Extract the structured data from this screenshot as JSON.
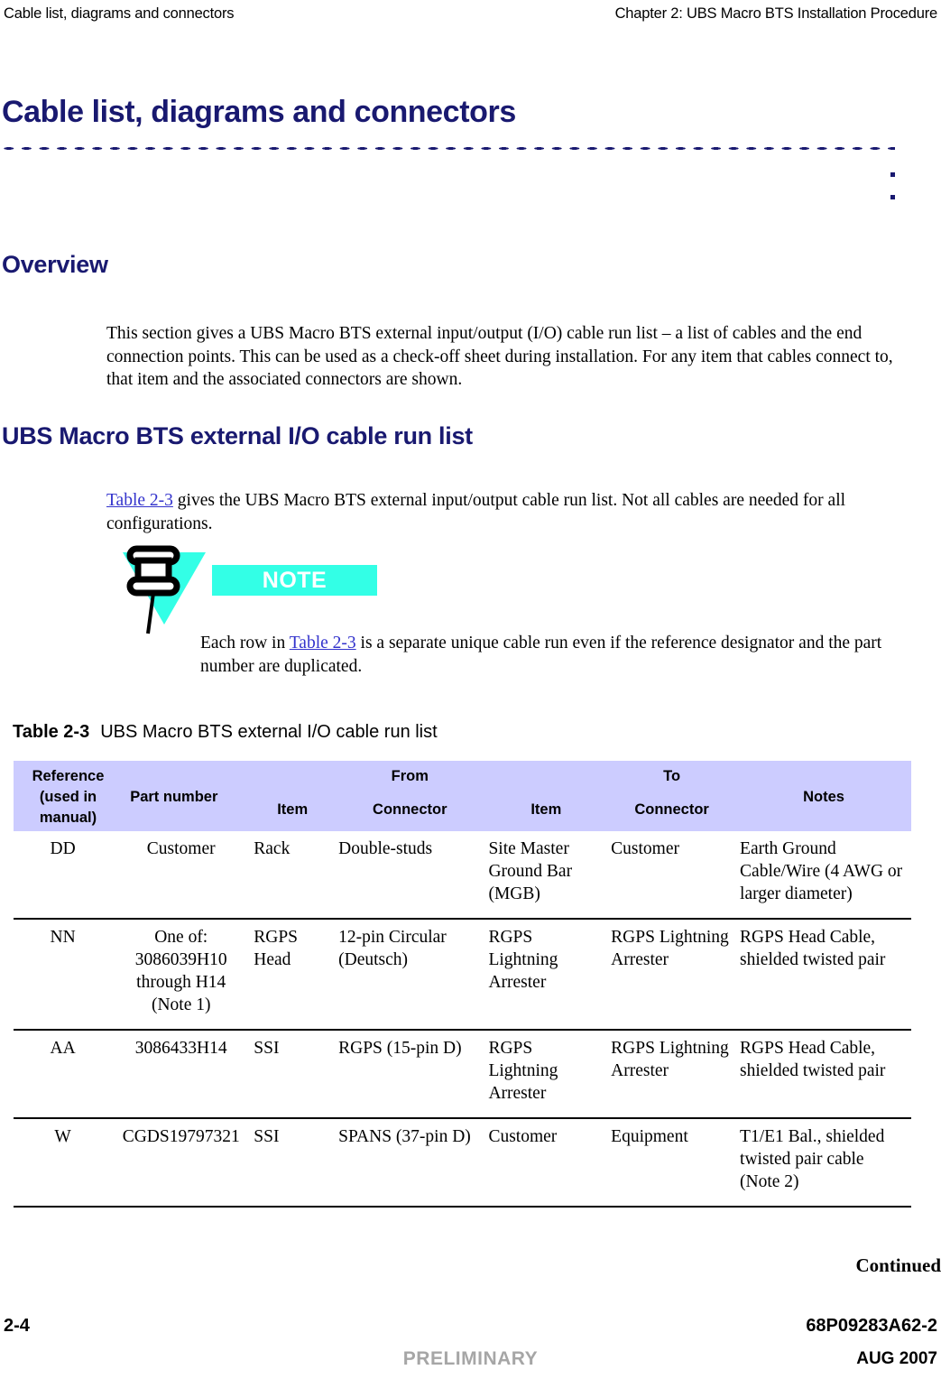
{
  "running_head": {
    "left": "Cable list, diagrams and connectors",
    "right": "Chapter 2: UBS Macro BTS Installation Procedure"
  },
  "chapter_title": "Cable list, diagrams and connectors",
  "sections": {
    "overview": {
      "heading": "Overview",
      "paragraph": "This section gives a UBS Macro BTS external input/output (I/O) cable run list – a list of cables and the end connection points. This can be used as a check-off sheet during installation. For any item that cables connect to, that item and the associated connectors are shown."
    },
    "runlist": {
      "heading": "UBS Macro BTS external I/O cable run list",
      "paragraph_xref": "Table 2-3",
      "paragraph_rest": " gives the UBS Macro BTS external input/output cable run list. Not all cables are needed for all configurations."
    }
  },
  "note": {
    "label": "NOTE",
    "text_before_xref": "Each row in ",
    "xref": "Table 2-3",
    "text_after_xref": " is a separate unique cable run even if the reference designator and the part number are duplicated."
  },
  "table": {
    "caption_number": "Table 2-3",
    "caption_text": "UBS Macro BTS external I/O cable run list",
    "header": {
      "reference": "Reference (used in manual)",
      "part_number": "Part number",
      "from": "From",
      "to": "To",
      "from_item": "Item",
      "from_connector": "Connector",
      "to_item": "Item",
      "to_connector": "Connector",
      "notes": "Notes"
    },
    "rows": [
      {
        "reference": "DD",
        "part_number": "Customer",
        "from_item": "Rack",
        "from_connector": "Double-studs",
        "to_item": "Site Master Ground Bar (MGB)",
        "to_connector": "Customer",
        "notes": "Earth Ground Cable/Wire (4 AWG or larger diameter)"
      },
      {
        "reference": "NN",
        "part_number": "One of: 3086039H10 through H14 (Note 1)",
        "from_item": "RGPS Head",
        "from_connector": "12-pin Circular (Deutsch)",
        "to_item": "RGPS Lightning Arrester",
        "to_connector": "RGPS Lightning Arrester",
        "notes": "RGPS Head Cable, shielded twisted pair"
      },
      {
        "reference": "AA",
        "part_number": "3086433H14",
        "from_item": "SSI",
        "from_connector": "RGPS (15-pin D)",
        "to_item": "RGPS Lightning Arrester",
        "to_connector": "RGPS Lightning Arrester",
        "notes": "RGPS Head Cable, shielded twisted pair"
      },
      {
        "reference": "W",
        "part_number": "CGDS19797321",
        "from_item": "SSI",
        "from_connector": "SPANS (37-pin D)",
        "to_item": "Customer",
        "to_connector": "Equipment",
        "notes": "T1/E1 Bal., shielded twisted pair cable (Note 2)"
      }
    ],
    "continued": "Continued"
  },
  "footer": {
    "page": "2-4",
    "part_number": "68P09283A62-2",
    "status": "PRELIMINARY",
    "date": "AUG 2007"
  },
  "colors": {
    "heading": "#191970",
    "xref_link": "#3333cc",
    "note_accent": "#33ffe6",
    "table_header_bg": "#ccccff",
    "footer_status": "#a6a6a6"
  }
}
